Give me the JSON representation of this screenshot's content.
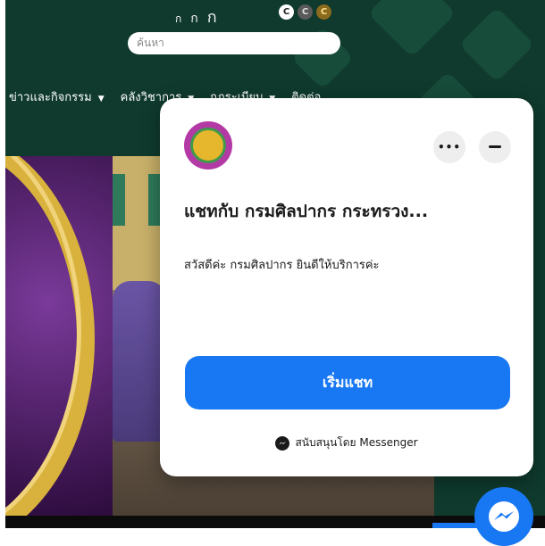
{
  "header": {
    "font_size_controls": [
      "ก",
      "ก",
      "ก"
    ],
    "contrast_controls": [
      "C",
      "C",
      "C"
    ],
    "search": {
      "placeholder": "ค้นหา"
    }
  },
  "nav": {
    "items": [
      {
        "label": "ข่าวและกิจกรรม"
      },
      {
        "label": "คลังวิชาการ"
      },
      {
        "label": "กฎระเบียบ"
      },
      {
        "label": "ติดต่อ"
      }
    ]
  },
  "chat_card": {
    "title": "แชทกับ กรมศิลปากร กระทรวง...",
    "greeting": "สวัสดีค่ะ กรมศิลปากร ยินดีให้บริการค่ะ",
    "start_button": "เริ่มแชท",
    "powered_by": "สนับสนุนโดย Messenger",
    "more_label": "•••"
  },
  "colors": {
    "accent": "#1877f2",
    "site_bg": "#0f3a2d"
  }
}
